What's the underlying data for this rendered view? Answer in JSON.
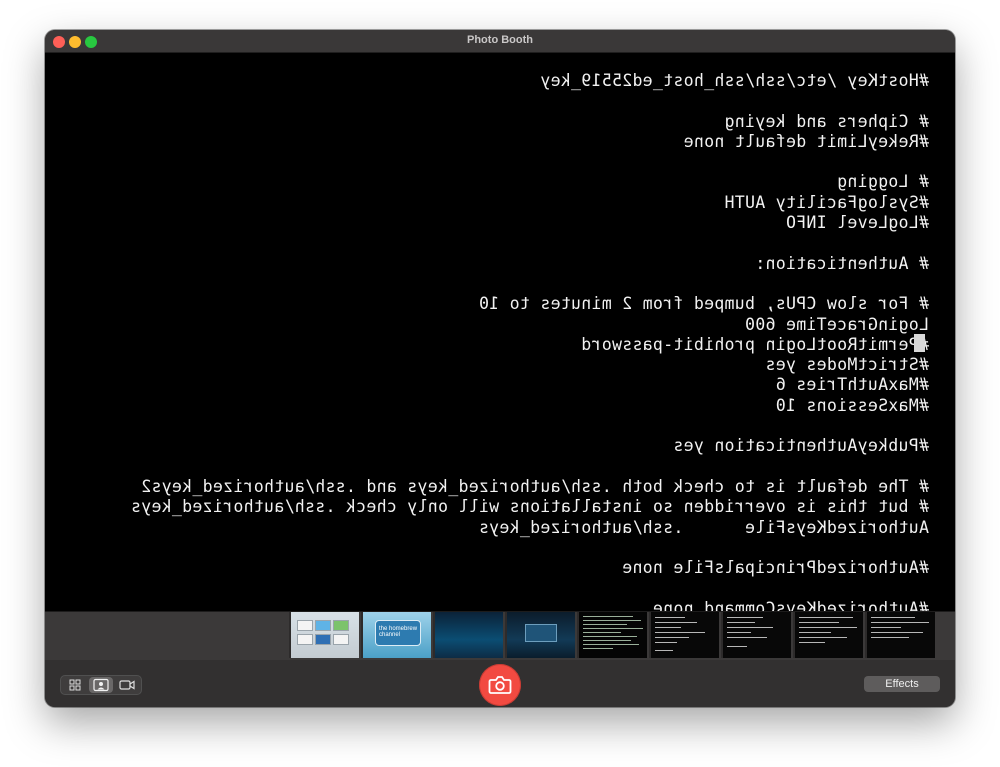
{
  "window": {
    "title": "Photo Booth"
  },
  "terminal": {
    "lines": [
      "#HostKey /etc/ssh/ssh_host_ed25519_key",
      "",
      "# Ciphers and keying",
      "#RekeyLimit default none",
      "",
      "# Logging",
      "#SyslogFacility AUTH",
      "#LogLevel INFO",
      "",
      "# Authentication:",
      "",
      "# For slow CPUs, bumped from 2 minutes to 10",
      "LoginGraceTime 600",
      "#PermitRootLogin prohibit-password",
      "#StrictModes yes",
      "#MaxAuthTries 6",
      "#MaxSessions 10",
      "",
      "#PubkeyAuthentication yes",
      "",
      "# The default is to check both .ssh/authorized_keys and .ssh/authorized_keys2",
      "# but this is overridden so installations will only check .ssh/authorized_keys",
      "AuthorizedKeysFile      .ssh/authorized_keys",
      "",
      "#AuthorizedPrincipalsFile none",
      "",
      "#AuthorizedKeysCommand none"
    ]
  },
  "thumbnails": {
    "items": [
      {
        "kind": "wii-menu"
      },
      {
        "kind": "homebrew-channel",
        "label": "the homebrew channel"
      },
      {
        "kind": "blue-screen"
      },
      {
        "kind": "dialog-screen"
      },
      {
        "kind": "terminal-green"
      },
      {
        "kind": "terminal"
      },
      {
        "kind": "terminal"
      },
      {
        "kind": "terminal"
      },
      {
        "kind": "terminal"
      }
    ]
  },
  "toolbar": {
    "view_modes": [
      {
        "icon": "grid-icon",
        "active": false
      },
      {
        "icon": "portrait-icon",
        "active": true
      },
      {
        "icon": "video-icon",
        "active": false
      }
    ],
    "shutter_icon": "camera-icon",
    "effects_label": "Effects"
  }
}
